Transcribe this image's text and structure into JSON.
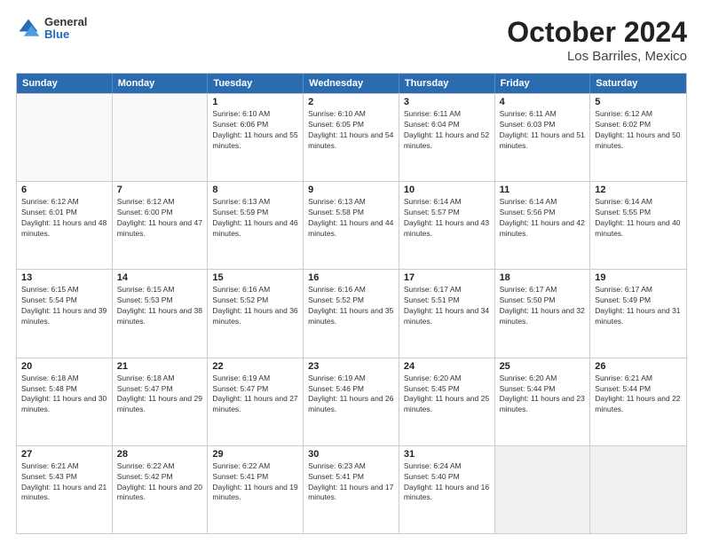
{
  "logo": {
    "general": "General",
    "blue": "Blue"
  },
  "title": "October 2024",
  "subtitle": "Los Barriles, Mexico",
  "days": [
    "Sunday",
    "Monday",
    "Tuesday",
    "Wednesday",
    "Thursday",
    "Friday",
    "Saturday"
  ],
  "weeks": [
    [
      {
        "day": "",
        "info": ""
      },
      {
        "day": "",
        "info": ""
      },
      {
        "day": "1",
        "info": "Sunrise: 6:10 AM\nSunset: 6:06 PM\nDaylight: 11 hours and 55 minutes."
      },
      {
        "day": "2",
        "info": "Sunrise: 6:10 AM\nSunset: 6:05 PM\nDaylight: 11 hours and 54 minutes."
      },
      {
        "day": "3",
        "info": "Sunrise: 6:11 AM\nSunset: 6:04 PM\nDaylight: 11 hours and 52 minutes."
      },
      {
        "day": "4",
        "info": "Sunrise: 6:11 AM\nSunset: 6:03 PM\nDaylight: 11 hours and 51 minutes."
      },
      {
        "day": "5",
        "info": "Sunrise: 6:12 AM\nSunset: 6:02 PM\nDaylight: 11 hours and 50 minutes."
      }
    ],
    [
      {
        "day": "6",
        "info": "Sunrise: 6:12 AM\nSunset: 6:01 PM\nDaylight: 11 hours and 48 minutes."
      },
      {
        "day": "7",
        "info": "Sunrise: 6:12 AM\nSunset: 6:00 PM\nDaylight: 11 hours and 47 minutes."
      },
      {
        "day": "8",
        "info": "Sunrise: 6:13 AM\nSunset: 5:59 PM\nDaylight: 11 hours and 46 minutes."
      },
      {
        "day": "9",
        "info": "Sunrise: 6:13 AM\nSunset: 5:58 PM\nDaylight: 11 hours and 44 minutes."
      },
      {
        "day": "10",
        "info": "Sunrise: 6:14 AM\nSunset: 5:57 PM\nDaylight: 11 hours and 43 minutes."
      },
      {
        "day": "11",
        "info": "Sunrise: 6:14 AM\nSunset: 5:56 PM\nDaylight: 11 hours and 42 minutes."
      },
      {
        "day": "12",
        "info": "Sunrise: 6:14 AM\nSunset: 5:55 PM\nDaylight: 11 hours and 40 minutes."
      }
    ],
    [
      {
        "day": "13",
        "info": "Sunrise: 6:15 AM\nSunset: 5:54 PM\nDaylight: 11 hours and 39 minutes."
      },
      {
        "day": "14",
        "info": "Sunrise: 6:15 AM\nSunset: 5:53 PM\nDaylight: 11 hours and 38 minutes."
      },
      {
        "day": "15",
        "info": "Sunrise: 6:16 AM\nSunset: 5:52 PM\nDaylight: 11 hours and 36 minutes."
      },
      {
        "day": "16",
        "info": "Sunrise: 6:16 AM\nSunset: 5:52 PM\nDaylight: 11 hours and 35 minutes."
      },
      {
        "day": "17",
        "info": "Sunrise: 6:17 AM\nSunset: 5:51 PM\nDaylight: 11 hours and 34 minutes."
      },
      {
        "day": "18",
        "info": "Sunrise: 6:17 AM\nSunset: 5:50 PM\nDaylight: 11 hours and 32 minutes."
      },
      {
        "day": "19",
        "info": "Sunrise: 6:17 AM\nSunset: 5:49 PM\nDaylight: 11 hours and 31 minutes."
      }
    ],
    [
      {
        "day": "20",
        "info": "Sunrise: 6:18 AM\nSunset: 5:48 PM\nDaylight: 11 hours and 30 minutes."
      },
      {
        "day": "21",
        "info": "Sunrise: 6:18 AM\nSunset: 5:47 PM\nDaylight: 11 hours and 29 minutes."
      },
      {
        "day": "22",
        "info": "Sunrise: 6:19 AM\nSunset: 5:47 PM\nDaylight: 11 hours and 27 minutes."
      },
      {
        "day": "23",
        "info": "Sunrise: 6:19 AM\nSunset: 5:46 PM\nDaylight: 11 hours and 26 minutes."
      },
      {
        "day": "24",
        "info": "Sunrise: 6:20 AM\nSunset: 5:45 PM\nDaylight: 11 hours and 25 minutes."
      },
      {
        "day": "25",
        "info": "Sunrise: 6:20 AM\nSunset: 5:44 PM\nDaylight: 11 hours and 23 minutes."
      },
      {
        "day": "26",
        "info": "Sunrise: 6:21 AM\nSunset: 5:44 PM\nDaylight: 11 hours and 22 minutes."
      }
    ],
    [
      {
        "day": "27",
        "info": "Sunrise: 6:21 AM\nSunset: 5:43 PM\nDaylight: 11 hours and 21 minutes."
      },
      {
        "day": "28",
        "info": "Sunrise: 6:22 AM\nSunset: 5:42 PM\nDaylight: 11 hours and 20 minutes."
      },
      {
        "day": "29",
        "info": "Sunrise: 6:22 AM\nSunset: 5:41 PM\nDaylight: 11 hours and 19 minutes."
      },
      {
        "day": "30",
        "info": "Sunrise: 6:23 AM\nSunset: 5:41 PM\nDaylight: 11 hours and 17 minutes."
      },
      {
        "day": "31",
        "info": "Sunrise: 6:24 AM\nSunset: 5:40 PM\nDaylight: 11 hours and 16 minutes."
      },
      {
        "day": "",
        "info": ""
      },
      {
        "day": "",
        "info": ""
      }
    ]
  ]
}
